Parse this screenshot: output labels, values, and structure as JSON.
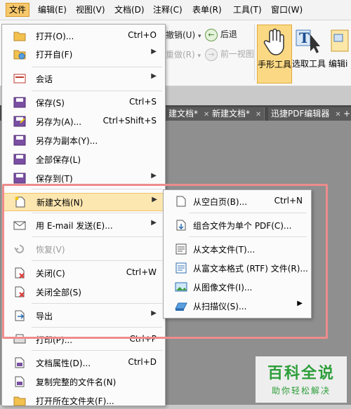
{
  "menubar": {
    "items": [
      "文件",
      "编辑(E)",
      "视图(V)",
      "文档(D)",
      "注释(C)",
      "表单(R)",
      "工具(T)",
      "窗口(W)"
    ]
  },
  "ribbon": {
    "undo": "撤销(U)",
    "back": "后退",
    "redo": "重做(R)",
    "prev_view": "前一视图",
    "hand_tool": "手形工具",
    "select_text": "选取工具",
    "edit_partial": "编辑i"
  },
  "tabs": [
    {
      "label": "建文档",
      "mark": "*"
    },
    {
      "label": "新建文档",
      "mark": "*"
    },
    {
      "label": "迅捷PDF编辑器",
      "mark": ""
    }
  ],
  "file_menu": {
    "items": [
      {
        "label": "打开(O)...",
        "shortcut": "Ctrl+O",
        "icon": "folder-open-icon",
        "submenu": false,
        "disabled": false
      },
      {
        "label": "打开自(F)",
        "shortcut": "",
        "icon": "folder-globe-icon",
        "submenu": true,
        "disabled": false
      },
      {
        "label": "会话",
        "shortcut": "",
        "icon": "session-icon",
        "submenu": true,
        "disabled": false
      },
      {
        "label": "保存(S)",
        "shortcut": "Ctrl+S",
        "icon": "save-icon",
        "submenu": false,
        "disabled": false
      },
      {
        "label": "另存为(A)...",
        "shortcut": "Ctrl+Shift+S",
        "icon": "save-as-icon",
        "submenu": false,
        "disabled": false
      },
      {
        "label": "另存为副本(Y)...",
        "shortcut": "",
        "icon": "save-copy-icon",
        "submenu": false,
        "disabled": false
      },
      {
        "label": "全部保存(L)",
        "shortcut": "",
        "icon": "save-all-icon",
        "submenu": false,
        "disabled": false
      },
      {
        "label": "保存到(T)",
        "shortcut": "",
        "icon": "save-to-icon",
        "submenu": true,
        "disabled": false
      },
      {
        "label": "新建文档(N)",
        "shortcut": "",
        "icon": "new-document-icon",
        "submenu": true,
        "disabled": false
      },
      {
        "label": "用 E-mail 发送(E)...",
        "shortcut": "",
        "icon": "email-icon",
        "submenu": true,
        "disabled": false
      },
      {
        "label": "恢复(V)",
        "shortcut": "",
        "icon": "revert-icon",
        "submenu": false,
        "disabled": true
      },
      {
        "label": "关闭(C)",
        "shortcut": "Ctrl+W",
        "icon": "close-doc-icon",
        "submenu": false,
        "disabled": false
      },
      {
        "label": "关闭全部(S)",
        "shortcut": "",
        "icon": "close-all-icon",
        "submenu": false,
        "disabled": false
      },
      {
        "label": "导出",
        "shortcut": "",
        "icon": "export-icon",
        "submenu": true,
        "disabled": false
      },
      {
        "label": "打印(P)...",
        "shortcut": "Ctrl+P",
        "icon": "print-icon",
        "submenu": false,
        "disabled": false
      },
      {
        "label": "文档属性(D)...",
        "shortcut": "Ctrl+D",
        "icon": "properties-icon",
        "submenu": false,
        "disabled": false
      },
      {
        "label": "复制完整的文件名(N)",
        "shortcut": "",
        "icon": "copy-filename-icon",
        "submenu": false,
        "disabled": false
      },
      {
        "label": "打开所在文件夹(F)...",
        "shortcut": "",
        "icon": "open-folder-icon",
        "submenu": false,
        "disabled": false
      }
    ]
  },
  "new_doc_submenu": {
    "items": [
      {
        "label": "从空白页(B)...",
        "shortcut": "Ctrl+N",
        "icon": "blank-page-icon",
        "submenu": false
      },
      {
        "label": "组合文件为单个 PDF(C)...",
        "shortcut": "",
        "icon": "combine-files-icon",
        "submenu": false
      },
      {
        "label": "从文本文件(T)...",
        "shortcut": "",
        "icon": "text-file-icon",
        "submenu": false
      },
      {
        "label": "从富文本格式 (RTF) 文件(R)...",
        "shortcut": "",
        "icon": "rtf-file-icon",
        "submenu": false
      },
      {
        "label": "从图像文件(I)...",
        "shortcut": "",
        "icon": "image-file-icon",
        "submenu": false
      },
      {
        "label": "从扫描仪(S)...",
        "shortcut": "",
        "icon": "scanner-icon",
        "submenu": true
      }
    ]
  },
  "watermark": {
    "line1": "百科全说",
    "line2": "助你轻松解决"
  },
  "colors": {
    "highlight": "#fde7b0",
    "outline": "#ee8c8c",
    "watermark": "#2d9e3a"
  }
}
